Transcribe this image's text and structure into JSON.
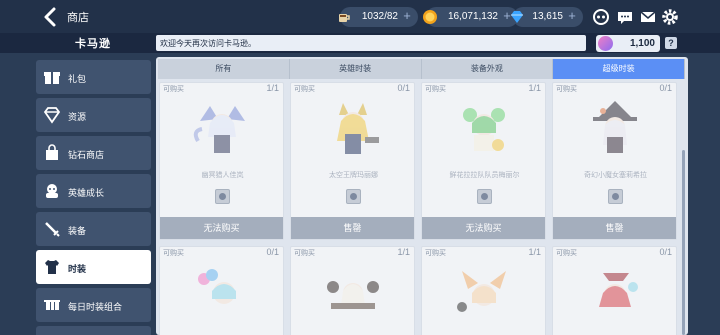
{
  "header": {
    "title": "商店",
    "currencies": [
      {
        "icon": "coffee-icon",
        "value": "1032/82",
        "color": "#f2c94c"
      },
      {
        "icon": "gold-coin-icon",
        "value": "16,071,132",
        "color": "#f2a31c"
      },
      {
        "icon": "diamond-icon",
        "value": "13,615",
        "color": "#3aa4ff"
      }
    ]
  },
  "subbar": {
    "logo": "卡马逊",
    "welcome": "欢迎今天再次访问卡马逊。",
    "coupon_value": "1,100",
    "help_label": "?"
  },
  "sidebar": {
    "items": [
      {
        "label": "礼包",
        "icon": "gift-icon",
        "active": false
      },
      {
        "label": "资源",
        "icon": "diamond-outline-icon",
        "active": false
      },
      {
        "label": "钻石商店",
        "icon": "shopping-bag-icon",
        "active": false
      },
      {
        "label": "英雄成长",
        "icon": "hero-growth-icon",
        "active": false
      },
      {
        "label": "装备",
        "icon": "sword-icon",
        "active": false
      },
      {
        "label": "时装",
        "icon": "shirt-icon",
        "active": true
      },
      {
        "label": "每日时装组合",
        "icon": "clothes-rack-icon",
        "active": false
      }
    ]
  },
  "tabs": [
    "所有",
    "英雄时装",
    "装备外观",
    "超级时装"
  ],
  "active_tab": 3,
  "cards_row1": [
    {
      "tag": "可购买",
      "count": "1/1",
      "name": "幽冥猎人佳岚",
      "footer": "无法购买"
    },
    {
      "tag": "可购买",
      "count": "0/1",
      "name": "太空王牌玛丽娜",
      "footer": "售罄"
    },
    {
      "tag": "可购买",
      "count": "1/1",
      "name": "鲜花拉拉队队员梅丽尔",
      "footer": "无法购买"
    },
    {
      "tag": "可购买",
      "count": "0/1",
      "name": "奇幻小魔女塞莉希拉",
      "footer": "售罄"
    }
  ],
  "cards_row2": [
    {
      "tag": "可购买",
      "count": "0/1"
    },
    {
      "tag": "可购买",
      "count": "1/1"
    },
    {
      "tag": "可购买",
      "count": "1/1"
    },
    {
      "tag": "可购买",
      "count": "0/1"
    }
  ]
}
